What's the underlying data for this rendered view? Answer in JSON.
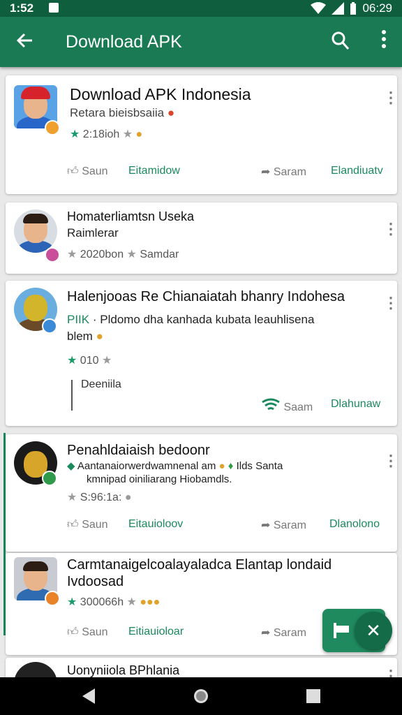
{
  "status": {
    "time": "1:52",
    "clock": "06:29"
  },
  "appbar": {
    "title": "Download APK"
  },
  "cards": [
    {
      "title": "Download APK Indonesia",
      "subtitle": "Retara bieisbsaiia",
      "meta": "2:18ioh",
      "a1": "Saun",
      "a2": "Eitamidow",
      "a3": "Saram",
      "a4": "Elandiuatv"
    },
    {
      "title": "Homaterliamtsn Useka",
      "subtitle": "Raimlerar",
      "meta": "2020bon",
      "meta2": "Samdar"
    },
    {
      "title": "Halenjooas Re Chianaiatah bhanry Indohesa",
      "subtitle_tag": "PIIK",
      "subtitle": "· Pldomo dha kanhada kubata leauhlisena",
      "subtitle2": "blem",
      "meta": "010",
      "poll": "Deeniila",
      "a3": "Saam",
      "a4": "Dlahunaw"
    },
    {
      "title": "Penahldaiaish bedoonr",
      "line1": "Aantanaiorwerdwamnenal am",
      "line1b": "Ilds Santa",
      "line2": "kmnipad oiniliarang Hiobamdls.",
      "meta": "S:96:1a:",
      "a1": "Saun",
      "a2": "Eitauioloov",
      "a3": "Saram",
      "a4": "Dlanolono"
    },
    {
      "title": "Carmtanaigelcoalayaladca Elantap londaid",
      "title2": "Ivdoosad",
      "meta": "300066h",
      "a1": "Saun",
      "a2": "Eitiauioloar",
      "a3": "Saram"
    },
    {
      "title": "Uonyniiola BPhlania"
    }
  ],
  "icons": [
    "back-arrow-icon",
    "search-icon",
    "more-vert-icon",
    "thumb-up-icon",
    "share-icon",
    "star-icon",
    "wifi-icon",
    "close-icon"
  ],
  "colors": {
    "primary": "#1a7a54",
    "statusbar": "#0f5e3e",
    "accent": "#1d9a6c"
  }
}
